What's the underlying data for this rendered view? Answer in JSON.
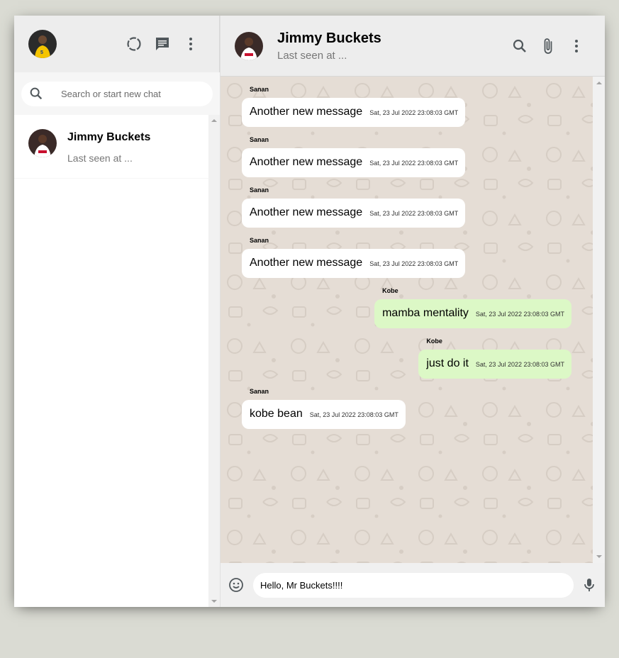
{
  "sidebar": {
    "search": {
      "placeholder": "Search or start new chat"
    },
    "chats": [
      {
        "name": "Jimmy Buckets",
        "last_message": "Last seen at ..."
      }
    ]
  },
  "chat_header": {
    "name": "Jimmy Buckets",
    "status": "Last seen at ..."
  },
  "messages": [
    {
      "sender": "Sanan",
      "text": "Another new message",
      "time": "Sat, 23 Jul 2022 23:08:03 GMT",
      "direction": "received"
    },
    {
      "sender": "Sanan",
      "text": "Another new message",
      "time": "Sat, 23 Jul 2022 23:08:03 GMT",
      "direction": "received"
    },
    {
      "sender": "Sanan",
      "text": "Another new message",
      "time": "Sat, 23 Jul 2022 23:08:03 GMT",
      "direction": "received"
    },
    {
      "sender": "Sanan",
      "text": "Another new message",
      "time": "Sat, 23 Jul 2022 23:08:03 GMT",
      "direction": "received"
    },
    {
      "sender": "Kobe",
      "text": "mamba mentality",
      "time": "Sat, 23 Jul 2022 23:08:03 GMT",
      "direction": "sent"
    },
    {
      "sender": "Kobe",
      "text": "just do it",
      "time": "Sat, 23 Jul 2022 23:08:03 GMT",
      "direction": "sent"
    },
    {
      "sender": "Sanan",
      "text": "kobe bean",
      "time": "Sat, 23 Jul 2022 23:08:03 GMT",
      "direction": "received"
    }
  ],
  "composer": {
    "value": "Hello, Mr Buckets!!!!"
  },
  "colors": {
    "page_bg": "#dadbd3",
    "header_bg": "#ededed",
    "chat_bg": "#e5ddd5",
    "sent_bubble": "#dcf8c6",
    "received_bubble": "#ffffff",
    "icon": "#51585c"
  },
  "icons": {
    "sidebar_header": [
      "status-icon",
      "new-chat-icon",
      "more-vert-icon"
    ],
    "chat_header": [
      "search-icon",
      "attach-icon",
      "more-vert-icon"
    ],
    "footer": [
      "emoji-icon",
      "mic-icon"
    ]
  }
}
